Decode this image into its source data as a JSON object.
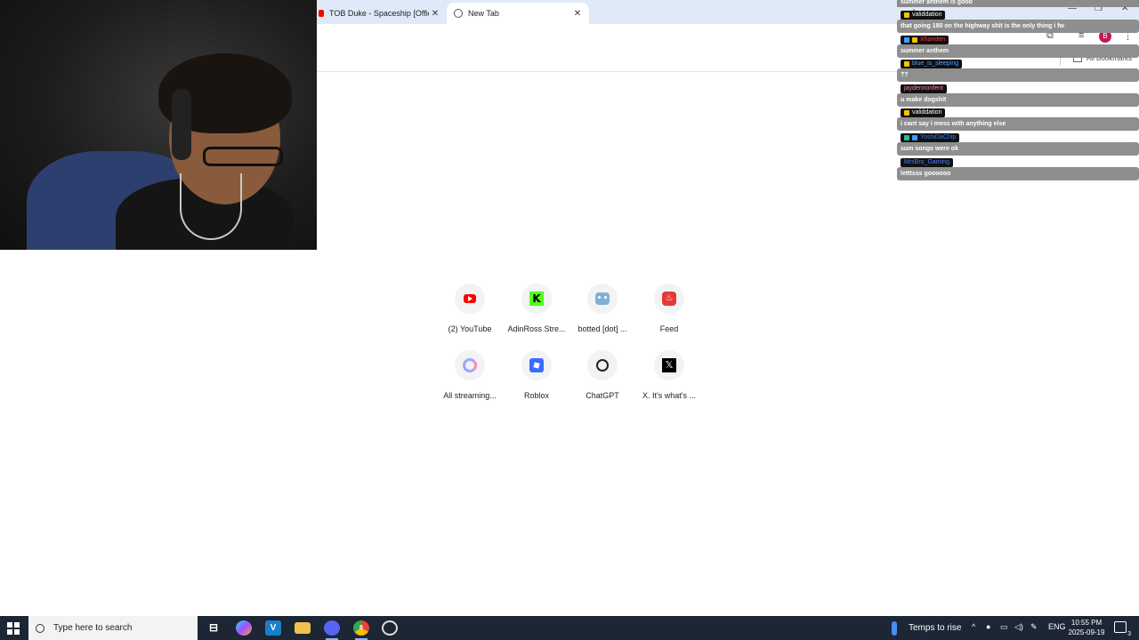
{
  "browser": {
    "tabs": [
      {
        "title": "TOB Duke - Spaceship [Official",
        "active": false
      },
      {
        "title": "New Tab",
        "active": true
      }
    ],
    "new_tab_symbol": "+",
    "close_symbol": "✕",
    "window_controls": {
      "minimize": "—",
      "maximize": "❐",
      "close": "✕"
    },
    "profile_initial": "B",
    "all_bookmarks_label": "All Bookmarks"
  },
  "chat": {
    "top_partial": "summer anthem is good",
    "messages": [
      {
        "user": "validdation",
        "user_color": "#ffffff",
        "text": "that going 180 on the highway shit is the only thing i fw"
      },
      {
        "user": "Xhanden",
        "user_color": "#ff3b3b",
        "text": "summer anthem"
      },
      {
        "user": "blue_is_sleeping",
        "user_color": "#4a9dff",
        "text": "??"
      },
      {
        "user": "jaydennonfent",
        "user_color": "#ff7fa6",
        "text": "u make dogshit"
      },
      {
        "user": "validdation",
        "user_color": "#ffffff",
        "text": "i cant say i mess with anything else"
      },
      {
        "user": "YoshiDaChip",
        "user_color": "#2f7bff",
        "text": "sum songs were ok"
      },
      {
        "user": "MrsBro_Gaming",
        "user_color": "#4a7dff",
        "text": "letttsss goooooo"
      }
    ]
  },
  "shortcuts": [
    {
      "label": "(2) YouTube",
      "icon": "youtube-icon"
    },
    {
      "label": "AdinRoss Stre...",
      "icon": "kick-icon",
      "glyph": "K"
    },
    {
      "label": "botted [dot] ...",
      "icon": "robot-icon"
    },
    {
      "label": "Feed",
      "icon": "feed-icon",
      "glyph": "♨"
    },
    {
      "label": "All streaming...",
      "icon": "streaming-icon"
    },
    {
      "label": "Roblox",
      "icon": "roblox-icon"
    },
    {
      "label": "ChatGPT",
      "icon": "chatgpt-icon"
    },
    {
      "label": "X. It's what's ...",
      "icon": "x-icon",
      "glyph": "𝕏"
    }
  ],
  "taskbar": {
    "search_placeholder": "Type here to search",
    "weather": "Temps to rise",
    "language": "ENG",
    "time": "10:55 PM",
    "date": "2025-09-19",
    "notification_count": "3",
    "chrome_badge": "8"
  }
}
